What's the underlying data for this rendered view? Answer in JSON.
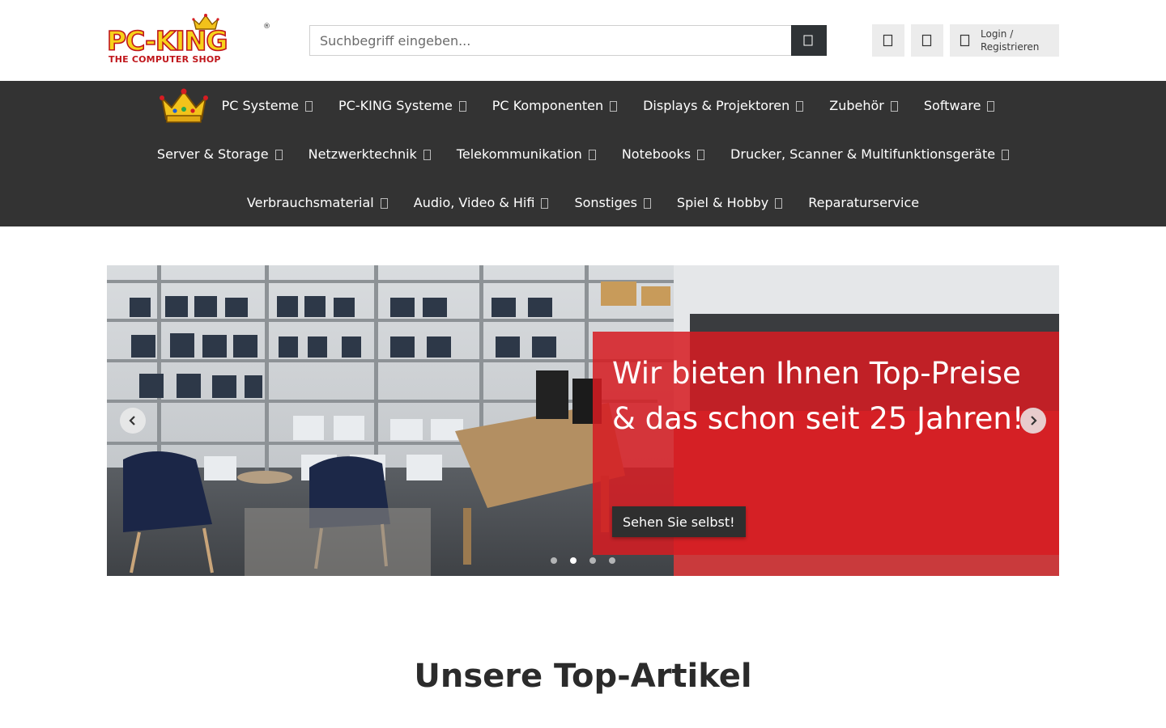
{
  "header": {
    "logo_text": "PC-KING",
    "logo_subtext": "THE COMPUTER SHOP",
    "logo_registered": "®",
    "search": {
      "placeholder": "Suchbegriff eingeben...",
      "button_icon": "search-icon"
    },
    "icons": [
      "wishlist-icon",
      "compare-icon"
    ],
    "login": {
      "icon": "user-icon",
      "line1": "Login /",
      "line2": "Registrieren"
    }
  },
  "nav": {
    "rows": [
      [
        {
          "label": "PC Systeme",
          "has_dropdown": true
        },
        {
          "label": "PC-KING Systeme",
          "has_dropdown": true
        },
        {
          "label": "PC Komponenten",
          "has_dropdown": true
        },
        {
          "label": "Displays & Projektoren",
          "has_dropdown": true
        },
        {
          "label": "Zubehör",
          "has_dropdown": true
        },
        {
          "label": "Software",
          "has_dropdown": true
        }
      ],
      [
        {
          "label": "Server & Storage",
          "has_dropdown": true
        },
        {
          "label": "Netzwerktechnik",
          "has_dropdown": true
        },
        {
          "label": "Telekommunikation",
          "has_dropdown": true
        },
        {
          "label": "Notebooks",
          "has_dropdown": true
        },
        {
          "label": "Drucker, Scanner & Multifunktionsgeräte",
          "has_dropdown": true
        }
      ],
      [
        {
          "label": "Verbrauchsmaterial",
          "has_dropdown": true
        },
        {
          "label": "Audio, Video & Hifi",
          "has_dropdown": true
        },
        {
          "label": "Sonstiges",
          "has_dropdown": true
        },
        {
          "label": "Spiel & Hobby",
          "has_dropdown": true
        },
        {
          "label": "Reparaturservice",
          "has_dropdown": false
        }
      ]
    ]
  },
  "slider": {
    "caption_title": "Wir bieten Ihnen Top-Preise & das schon seit 25 Jahren!",
    "caption_button": "Sehen Sie selbst!",
    "dot_count": 4,
    "active_dot": 2,
    "colors": {
      "caption_bg": "#d61c22"
    }
  },
  "main": {
    "section_title": "Unsere Top-Artikel"
  },
  "colors": {
    "nav_bg": "#333333",
    "search_button": "#2f3336",
    "brand_red": "#c0161b",
    "brand_yellow": "#f7d21a"
  }
}
